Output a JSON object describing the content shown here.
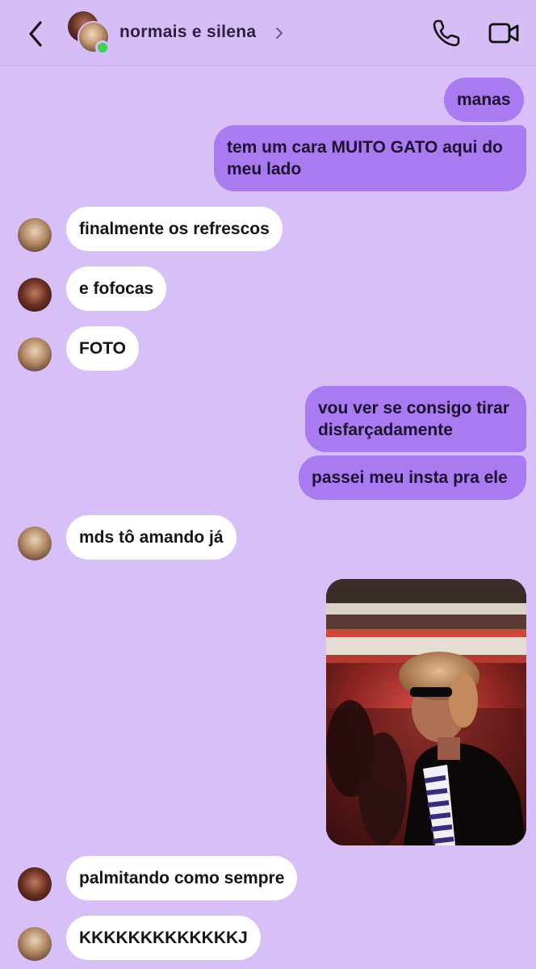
{
  "header": {
    "title": "normais e silena",
    "back_icon": "chevron-left-icon",
    "call_icon": "phone-icon",
    "video_icon": "video-camera-icon",
    "online_color": "#3bd251"
  },
  "messages": [
    {
      "sender": "me",
      "text": "manas"
    },
    {
      "sender": "me",
      "text_lines": [
        "tem um cara MUITO GATO aqui do",
        "meu lado"
      ]
    },
    {
      "sender": "them",
      "text": "finalmente os refrescos"
    },
    {
      "sender": "them",
      "text": "e fofocas"
    },
    {
      "sender": "them",
      "text": "FOTO"
    },
    {
      "sender": "me",
      "text_lines": [
        "vou ver se consigo tirar",
        "disfarçadamente"
      ]
    },
    {
      "sender": "me",
      "text": "passei meu insta pra ele"
    },
    {
      "sender": "them",
      "text": "mds tô amando já"
    },
    {
      "sender": "me",
      "type": "photo"
    },
    {
      "sender": "them",
      "text": "palmitando como sempre"
    },
    {
      "sender": "them",
      "text": "KKKKKKKKKKKKKJ"
    }
  ],
  "colors": {
    "background": "#d8bff8",
    "outgoing_bubble": "#a97af0",
    "incoming_bubble": "#ffffff"
  }
}
